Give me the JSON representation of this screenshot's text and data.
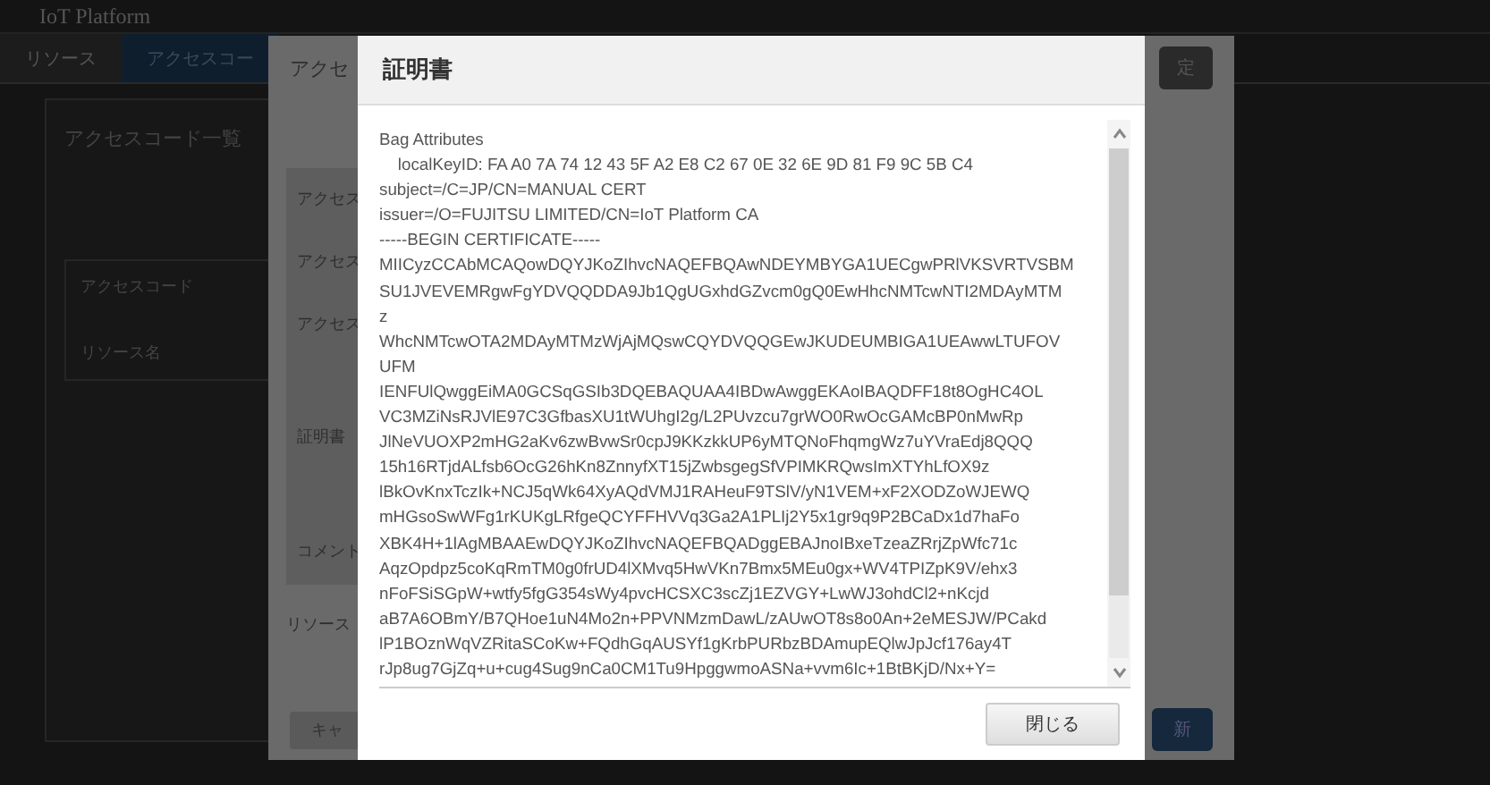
{
  "app": {
    "brand": "IoT Platform",
    "tabs": [
      {
        "label": "リソース",
        "selected": false
      },
      {
        "label": "アクセスコー",
        "selected": true
      }
    ],
    "panel_title": "アクセスコード一覧",
    "filter_labels": [
      "アクセスコード",
      "リソース名"
    ]
  },
  "edit_dialog": {
    "title": "アクセ",
    "top_button": "定",
    "field_labels": [
      "アクセス",
      "アクセス",
      "アクセス",
      "証明書",
      "コメント"
    ],
    "section_label": "リソース",
    "cancel_button": "キャ",
    "submit_button": "新"
  },
  "certificate_dialog": {
    "title": "証明書",
    "lines": [
      "Bag Attributes",
      "    localKeyID: FA A0 7A 74 12 43 5F A2 E8 C2 67 0E 32 6E 9D 81 F9 9C 5B C4",
      "subject=/C=JP/CN=MANUAL CERT",
      "issuer=/O=FUJITSU LIMITED/CN=IoT Platform CA",
      "-----BEGIN CERTIFICATE-----",
      "MIICyzCCAbMCAQowDQYJKoZIhvcNAQEFBQAwNDEYMBYGA1UECgwPRlVKSVRTVSBM",
      "SU1JVEVEMRgwFgYDVQQDDA9Jb1QgUGxhdGZvcm0gQ0EwHhcNMTcwNTI2MDAyMTM",
      "z",
      "WhcNMTcwOTA2MDAyMTMzWjAjMQswCQYDVQQGEwJKUDEUMBIGA1UEAwwLTUFOV",
      "UFM",
      "IENFUlQwggEiMA0GCSqGSIb3DQEBAQUAA4IBDwAwggEKAoIBAQDFF18t8OgHC4OL",
      "VC3MZiNsRJVlE97C3GfbasXU1tWUhgI2g/L2PUvzcu7grWO0RwOcGAMcBP0nMwRp",
      "JlNeVUOXP2mHG2aKv6zwBvwSr0cpJ9KKzkkUP6yMTQNoFhqmgWz7uYVraEdj8QQQ",
      "15h16RTjdALfsb6OcG26hKn8ZnnyfXT15jZwbsgegSfVPIMKRQwsImXTYhLfOX9z",
      "lBkOvKnxTczIk+NCJ5qWk64XyAQdVMJ1RAHeuF9TSlV/yN1VEM+xF2XODZoWJEWQ",
      "mHGsoSwWFg1rKUKgLRfgeQCYFFHVVq3Ga2A1PLIj2Y5x1gr9q9P2BCaDx1d7haFo",
      "XBK4H+1lAgMBAAEwDQYJKoZIhvcNAQEFBQADggEBAJnoIBxeTzeaZRrjZpWfc71c",
      "AqzOpdpz5coKqRmTM0g0frUD4lXMvq5HwVKn7Bmx5MEu0gx+WV4TPIZpK9V/ehx3",
      "nFoFSiSGpW+wtfy5fgG354sWy4pvcHCSXC3scZj1EZVGY+LwWJ3ohdCl2+nKcjd",
      "aB7A6OBmY/B7QHoe1uN4Mo2n+PPVNMzmDawL/zAUwOT8s8o0An+2eMESJW/PCakd",
      "lP1BOznWqVZRitaSCoKw+FQdhGqAUSYf1gKrbPURbzBDAmupEQlwJpJcf176ay4T",
      "rJp8ug7GjZq+u+cug4Sug9nCa0CM1Tu9HpggwmoASNa+vvm6Ic+1BtBKjD/Nx+Y="
    ],
    "close_button": "閉じる"
  }
}
